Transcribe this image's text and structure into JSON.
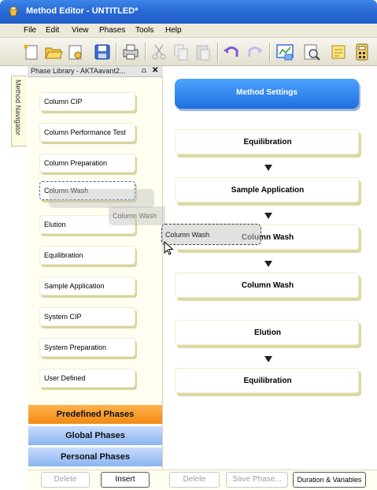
{
  "window": {
    "title": "Method Editor - UNTITLED*"
  },
  "menu": [
    "File",
    "Edit",
    "View",
    "Phases",
    "Tools",
    "Help"
  ],
  "toolbar_icons": [
    "new-method-icon",
    "open-folder-icon",
    "open-method-icon",
    "save-icon",
    "print-icon",
    "cut-icon",
    "copy-icon",
    "paste-icon",
    "undo-icon",
    "redo-icon",
    "method-view-icon",
    "print-preview-icon",
    "notes-icon",
    "calculator-icon"
  ],
  "navigator_tab": {
    "label": "Method Navigator"
  },
  "library": {
    "title": "Phase Library - AKTAavant2...",
    "phases": [
      "Column CIP",
      "Column Performance Test",
      "Column Preparation",
      "Column Wash",
      "Elution",
      "Equilibration",
      "Sample Application",
      "System CIP",
      "System Preparation",
      "User Defined"
    ],
    "ghost_label": "Column Wash",
    "categories": {
      "predefined": "Predefined Phases",
      "global": "Global Phases",
      "personal": "Personal Phases"
    },
    "buttons": {
      "delete": "Delete",
      "insert": "Insert"
    }
  },
  "method": {
    "settings_label": "Method Settings",
    "steps": [
      "Equilibration",
      "Sample Application",
      "Column Wash",
      "Column Wash",
      "Elution",
      "Equilibration"
    ],
    "drag_label": "Column Wash",
    "buttons": {
      "delete": "Delete",
      "save_phase": "Save Phase...",
      "duration": "Duration & Variables"
    }
  },
  "colors": {
    "accent": "#1f6fe0",
    "predefined": "#f28a14",
    "category": "#8ab4f0"
  }
}
